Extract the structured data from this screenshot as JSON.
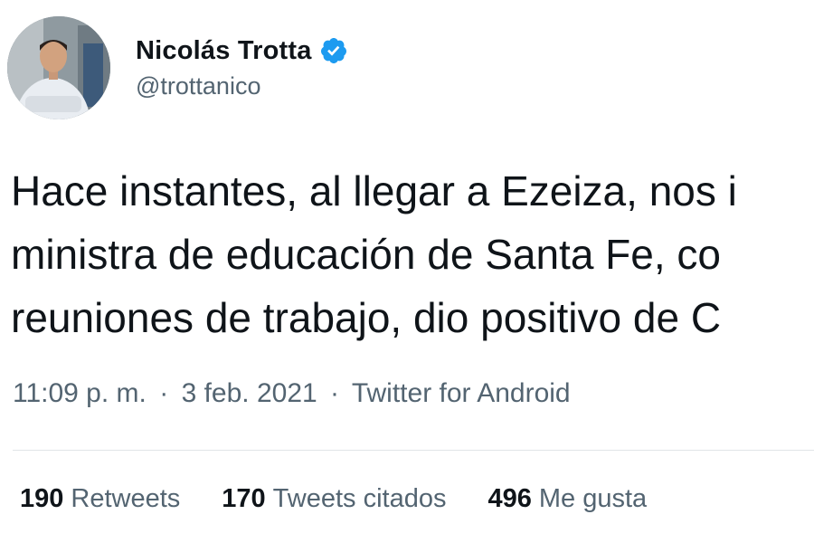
{
  "author": {
    "display_name": "Nicolás Trotta",
    "handle": "@trottanico",
    "verified": true,
    "verified_color": "#1d9bf0"
  },
  "tweet": {
    "lines": [
      "Hace instantes, al llegar a Ezeiza, nos i",
      "ministra de educación de Santa Fe, co",
      "reuniones de trabajo, dio positivo de C"
    ]
  },
  "meta": {
    "time": "11:09 p. m.",
    "separator": "·",
    "date": "3 feb. 2021",
    "source": "Twitter for Android"
  },
  "stats": [
    {
      "count": "190",
      "label": "Retweets"
    },
    {
      "count": "170",
      "label": "Tweets citados"
    },
    {
      "count": "496",
      "label": "Me gusta"
    }
  ],
  "colors": {
    "text_primary": "#0f1419",
    "text_secondary": "#536471",
    "divider": "#e1e5e8"
  }
}
